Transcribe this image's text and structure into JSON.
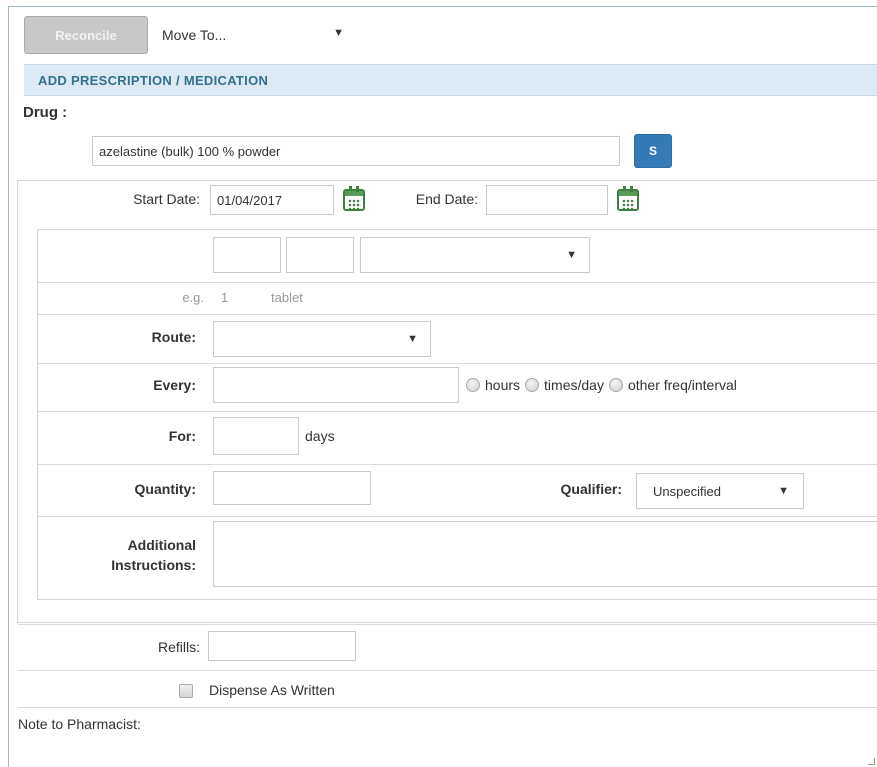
{
  "toolbar": {
    "reconcile_label": "Reconcile",
    "move_to_label": "Move To...",
    "move_to_arrow": "▼"
  },
  "section": {
    "title": "ADD PRESCRIPTION / MEDICATION"
  },
  "drug": {
    "label": "Drug :",
    "value": "azelastine (bulk) 100 % powder",
    "search_button_label": "S"
  },
  "dates": {
    "start_label": "Start Date:",
    "start_value": "01/04/2017",
    "end_label": "End Date:",
    "end_value": ""
  },
  "dose": {
    "amount_value": "",
    "unit_value": "",
    "form_value": "",
    "form_arrow": "▼",
    "example_prefix": "e.g.",
    "example_amount": "1",
    "example_form": "tablet"
  },
  "route": {
    "label": "Route:",
    "value": "",
    "arrow": "▼"
  },
  "every": {
    "label": "Every:",
    "value": "",
    "options": [
      "hours",
      "times/day",
      "other freq/interval"
    ]
  },
  "for": {
    "label": "For:",
    "value": "",
    "unit": "days"
  },
  "quantity": {
    "label": "Quantity:",
    "value": ""
  },
  "qualifier": {
    "label": "Qualifier:",
    "value": "Unspecified",
    "arrow": "▼"
  },
  "additional": {
    "label_line1": "Additional",
    "label_line2": "Instructions:",
    "value": ""
  },
  "refills": {
    "label": "Refills:",
    "value": ""
  },
  "daw": {
    "label": "Dispense As Written"
  },
  "note": {
    "label": "Note to Pharmacist:"
  },
  "colors": {
    "header_bg": "#dbeaf5",
    "header_text": "#31708f",
    "button_primary": "#337ab7",
    "calendar_green": "#3e7e3e"
  }
}
